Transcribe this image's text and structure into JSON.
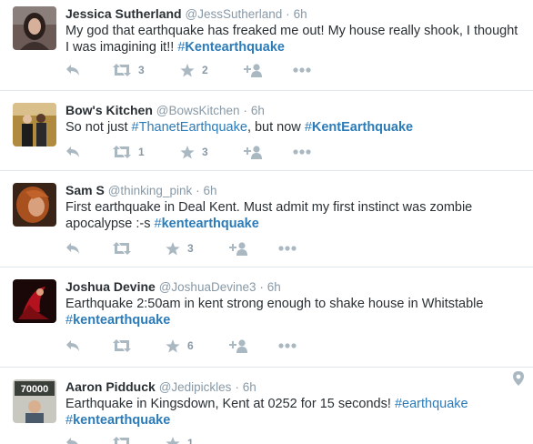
{
  "colors": {
    "link": "#2b7bb9",
    "action": "#aab8c2",
    "meta": "#8899a6",
    "text": "#292f33"
  },
  "tweets": [
    {
      "name": "Jessica Sutherland",
      "handle": "@JessSutherland",
      "dot": "·",
      "time": "6h",
      "text_1": "My god that earthquake has freaked me out! My house really shook, I thought I was imagining it!! ",
      "tag_1": "#",
      "tag_1b": "Kentearthquake",
      "text_2": "",
      "tag_2": "",
      "tag_2b": "",
      "retweets": "3",
      "favorites": "2"
    },
    {
      "name": "Bow's Kitchen",
      "handle": "@BowsKitchen",
      "dot": "·",
      "time": "6h",
      "text_1": "So not just ",
      "tag_1": "#",
      "tag_1b": "ThanetEarthquake",
      "text_2": ", but now ",
      "tag_2": "#",
      "tag_2b": "KentEarthquake",
      "retweets": "1",
      "favorites": "3"
    },
    {
      "name": "Sam S",
      "handle": "@thinking_pink",
      "dot": "·",
      "time": "6h",
      "text_1": "First earthquake in Deal Kent. Must admit my first instinct was zombie apocalypse :-s ",
      "tag_1": "#",
      "tag_1b": "kentearthquake",
      "text_2": "",
      "tag_2": "",
      "tag_2b": "",
      "retweets": "",
      "favorites": "3"
    },
    {
      "name": "Joshua Devine",
      "handle": "@JoshuaDevine3",
      "dot": "·",
      "time": "6h",
      "text_1": "Earthquake 2:50am in kent strong enough to shake house in Whitstable ",
      "tag_1": "#",
      "tag_1b": "kentearthquake",
      "text_2": "",
      "tag_2": "",
      "tag_2b": "",
      "retweets": "",
      "favorites": "6"
    },
    {
      "name": "Aaron Pidduck",
      "handle": "@Jedipickles",
      "dot": "·",
      "time": "6h",
      "text_1": "Earthquake in Kingsdown, Kent at 0252 for 15 seconds! ",
      "tag_1": "#",
      "tag_1b": "earthquake",
      "text_2": " ",
      "tag_2": "#",
      "tag_2b": "kentearthquake",
      "retweets": "",
      "favorites": "1",
      "avatar_text": "70000"
    }
  ]
}
